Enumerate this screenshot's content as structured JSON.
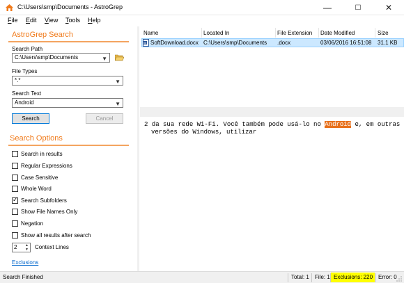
{
  "window": {
    "title": "C:\\Users\\smp\\Documents - AstroGrep",
    "min": "—",
    "max": "☐",
    "close": "✕"
  },
  "menu": {
    "file": {
      "u": "F",
      "rest": "ile"
    },
    "edit": {
      "u": "E",
      "rest": "dit"
    },
    "view": {
      "u": "V",
      "rest": "iew"
    },
    "tools": {
      "u": "T",
      "rest": "ools"
    },
    "help": {
      "u": "H",
      "rest": "elp"
    }
  },
  "search_panel": {
    "title": "AstroGrep Search",
    "search_path_label": "Search Path",
    "search_path_value": "C:\\Users\\smp\\Documents",
    "file_types_label": "File Types",
    "file_types_value": "*.*",
    "search_text_label": "Search Text",
    "search_text_value": "Android",
    "search_button": "Search",
    "cancel_button": "Cancel"
  },
  "options_panel": {
    "title": "Search Options",
    "options": [
      {
        "label": "Search in results",
        "checked": false
      },
      {
        "label": "Regular Expressions",
        "checked": false
      },
      {
        "label": "Case Sensitive",
        "checked": false
      },
      {
        "label": "Whole Word",
        "checked": false
      },
      {
        "label": "Search Subfolders",
        "checked": true
      },
      {
        "label": "Show File Names Only",
        "checked": false
      },
      {
        "label": "Negation",
        "checked": false
      },
      {
        "label": "Show all results after search",
        "checked": false
      }
    ],
    "context_lines_value": "2",
    "context_lines_label": "Context Lines",
    "exclusions_link": "Exclusions"
  },
  "results": {
    "columns": [
      "Name",
      "Located In",
      "File Extension",
      "Date Modified",
      "Size"
    ],
    "rows": [
      {
        "name": "SoftDownload.docx",
        "location": "C:\\Users\\smp\\Documents",
        "extension": ".docx",
        "modified": "03/06/2016 16:51:08",
        "size": "31.1 KB"
      }
    ]
  },
  "preview": {
    "line_number": "2",
    "before": "da sua rede Wi-Fi. Você também pode usá-lo no ",
    "match": "Android",
    "after": " e, em outras",
    "line2": "versões do Windows, utilizar"
  },
  "status": {
    "message": "Search Finished",
    "total": "Total: 1",
    "file": "File: 1",
    "exclusions": "Exclusions: 220",
    "error": "Error: 0"
  },
  "colors": {
    "accent": "#f07a1a",
    "highlight": "#e8701a",
    "selection": "#cce8ff",
    "exclusion_badge": "#ffff00"
  }
}
